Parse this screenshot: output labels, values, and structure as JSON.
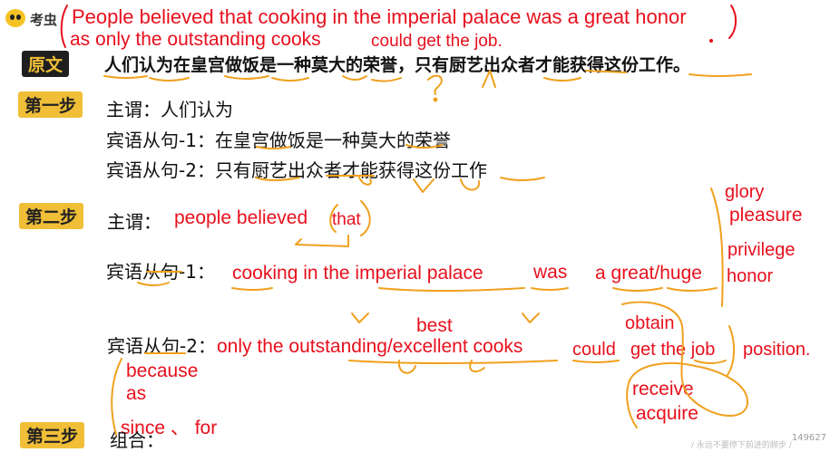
{
  "brand": {
    "name": "考虫"
  },
  "translation": {
    "line1": "People believed that cooking in the imperial palace was a great honor",
    "line2": "as only the outstanding cooks",
    "line2b": "could get the job."
  },
  "original": {
    "label": "原文",
    "text": "人们认为在皇宫做饭是一种莫大的荣誉，只有厨艺出众者才能获得这份工作。"
  },
  "step1": {
    "label": "第一步",
    "subject": "主谓：人们认为",
    "clause1": "宾语从句-1：在皇宫做饭是一种莫大的荣誉",
    "clause2": "宾语从句-2：只有厨艺出众者才能获得这份工作"
  },
  "step2": {
    "label": "第二步",
    "subject_label": "主谓：",
    "subject_en": "people believed",
    "subject_that": "that",
    "clause1_label": "宾语从句-1：",
    "clause1_en_a": "cooking  in the imperial palace",
    "clause1_en_b": "was",
    "clause1_en_c": "a great/huge",
    "clause1_syn1": "glory",
    "clause1_syn2": "pleasure",
    "clause1_syn3": "privilege",
    "clause1_syn4": "honor",
    "clause2_label": "宾语从句-2：",
    "clause2_en": "only the outstanding/excellent cooks",
    "clause2_best": "best",
    "clause2_could": "could",
    "clause2_get": "get the job",
    "clause2_position": "position.",
    "clause2_obtain": "obtain",
    "clause2_receive": "receive",
    "clause2_acquire": "acquire"
  },
  "conjunctions": {
    "because": "because",
    "as": "as",
    "since": "since 、 for"
  },
  "step3": {
    "label": "第三步",
    "text": "组合："
  },
  "watermark": {
    "id": "149627",
    "tagline": "/ 永远不要停下前进的脚步 /"
  },
  "colors": {
    "badge": "#f0bf37",
    "ink_red": "#e8101c",
    "ink_orange": "#f0a01e"
  }
}
